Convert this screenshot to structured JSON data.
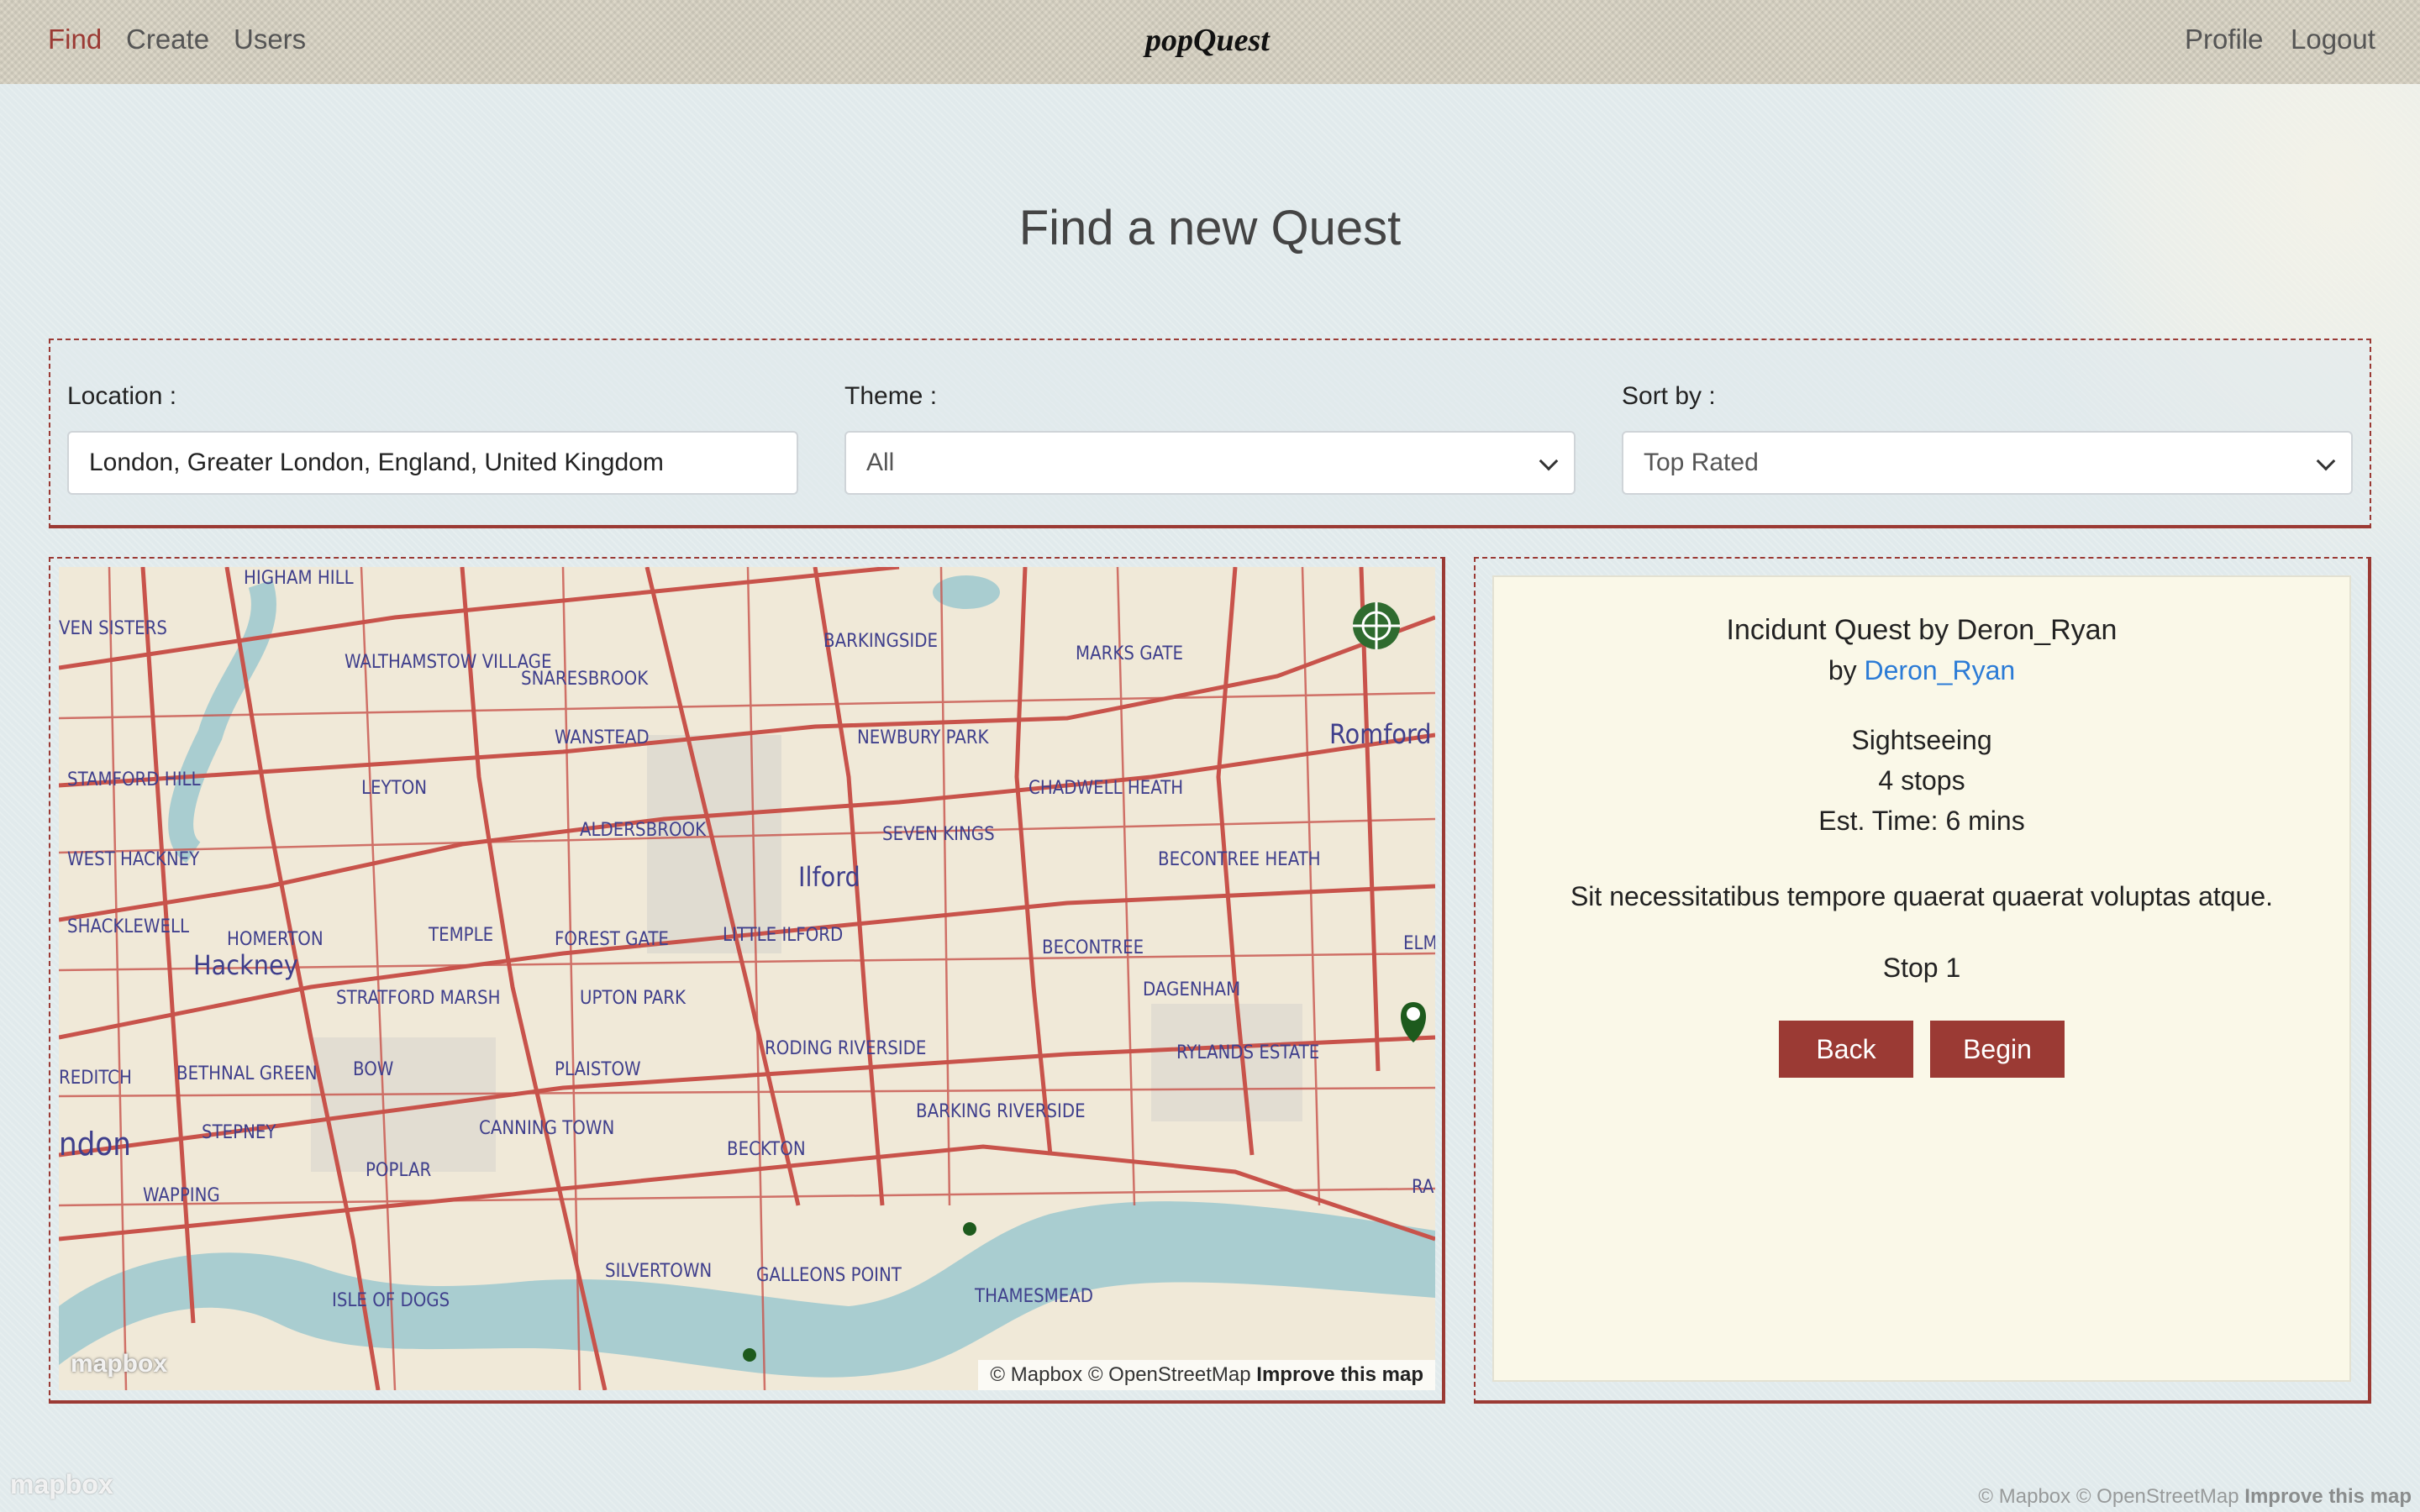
{
  "nav": {
    "find": "Find",
    "create": "Create",
    "users": "Users",
    "brand": "popQuest",
    "profile": "Profile",
    "logout": "Logout"
  },
  "page": {
    "title": "Find a new Quest"
  },
  "filters": {
    "location_label": "Location :",
    "location_value": "London, Greater London, England, United Kingdom",
    "theme_label": "Theme :",
    "theme_value": "All",
    "sort_label": "Sort by :",
    "sort_value": "Top Rated"
  },
  "map": {
    "labels": [
      "HIGHAM HILL",
      "WALTHAMSTOW VILLAGE",
      "SNARESBROOK",
      "BARKINGSIDE",
      "MARKS GATE",
      "WANSTEAD",
      "NEWBURY PARK",
      "Romford",
      "STAMFORD HILL",
      "LEYTON",
      "CHADWELL HEATH",
      "SEVEN KINGS",
      "ALDERSBROOK",
      "Ilford",
      "BECONTREE HEATH",
      "WEST HACKNEY",
      "SHACKLEWELL",
      "HOMERTON",
      "TEMPLE",
      "FOREST GATE",
      "LITTLE ILFORD",
      "BECONTREE",
      "Hackney",
      "STRATFORD MARSH",
      "UPTON PARK",
      "DAGENHAM",
      "RODING RIVERSIDE",
      "PLAISTOW",
      "RYLANDS ESTATE",
      "BETHNAL GREEN",
      "BOW",
      "STEPNEY",
      "CANNING TOWN",
      "BECKTON",
      "BARKING RIVERSIDE",
      "POPLAR",
      "WAPPING",
      "SILVERTOWN",
      "GALLEONS POINT",
      "ISLE OF DOGS",
      "THAMESMEAD",
      "ndon",
      "VEN SISTERS",
      "REDITCH",
      "ELM",
      "RAI"
    ],
    "attribution_text": "© Mapbox © OpenStreetMap",
    "attribution_link": "Improve this map",
    "logo": "mapbox"
  },
  "quest": {
    "title": "Incidunt Quest by Deron_Ryan",
    "by_prefix": "by",
    "author": "Deron_Ryan",
    "theme": "Sightseeing",
    "stops": "4 stops",
    "time": "Est. Time: 6 mins",
    "description": "Sit necessitatibus tempore quaerat quaerat voluptas atque.",
    "stop_label": "Stop 1",
    "back_label": "Back",
    "begin_label": "Begin"
  },
  "page_attribution": {
    "text": "© Mapbox © OpenStreetMap",
    "link": "Improve this map",
    "logo": "mapbox"
  },
  "colors": {
    "accent": "#9b3a34",
    "link": "#2b7bd6",
    "card_bg": "#faf8e8"
  }
}
